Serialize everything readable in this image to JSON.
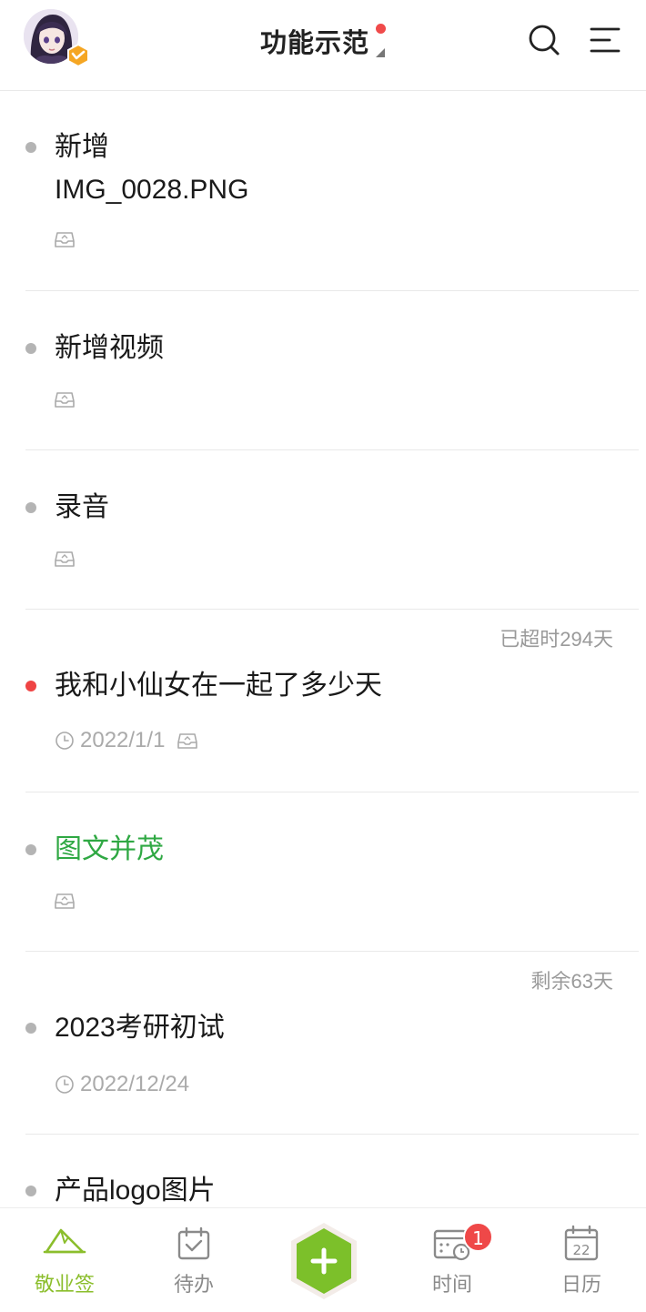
{
  "header": {
    "title": "功能示范",
    "colors": {
      "dot": "#f04a4a",
      "accent": "#8bbe2c"
    },
    "icons": [
      "avatar",
      "vip-badge-icon",
      "search-icon",
      "menu-icon"
    ]
  },
  "items": [
    {
      "title": "新增\nIMG_0028.PNG",
      "title_color": "default",
      "bullet": "gray",
      "date": "",
      "status": "",
      "icons": [
        "inbox-icon"
      ]
    },
    {
      "title": "新增视频",
      "title_color": "default",
      "bullet": "gray",
      "date": "",
      "status": "",
      "icons": [
        "inbox-icon"
      ]
    },
    {
      "title": "录音",
      "title_color": "default",
      "bullet": "gray",
      "date": "",
      "status": "",
      "icons": [
        "inbox-icon"
      ]
    },
    {
      "title": "我和小仙女在一起了多少天",
      "title_color": "default",
      "bullet": "red",
      "date": "2022/1/1",
      "status": "已超时294天",
      "icons": [
        "clock-icon",
        "inbox-icon"
      ]
    },
    {
      "title": "图文并茂",
      "title_color": "#2fa843",
      "bullet": "gray",
      "date": "",
      "status": "",
      "icons": [
        "inbox-icon"
      ]
    },
    {
      "title": "2023考研初试",
      "title_color": "default",
      "bullet": "gray",
      "date": "2022/12/24",
      "status": "剩余63天",
      "icons": [
        "clock-icon"
      ]
    },
    {
      "title": "产品logo图片",
      "title_color": "default",
      "bullet": "gray",
      "date": "",
      "status": "",
      "icons": []
    }
  ],
  "bottom_nav": {
    "items": [
      {
        "label": "敬业签",
        "icon": "note-icon",
        "active": true
      },
      {
        "label": "待办",
        "icon": "todo-check-icon",
        "active": false
      },
      {
        "label": "",
        "icon": "add-icon",
        "active": false
      },
      {
        "label": "时间",
        "icon": "calendar-clock-icon",
        "active": false,
        "badge": "1"
      },
      {
        "label": "日历",
        "icon": "calendar-day-icon",
        "active": false,
        "calendar_day": "22"
      }
    ],
    "active_color": "#8bbe2c",
    "fab_color": "#7cc02a"
  }
}
